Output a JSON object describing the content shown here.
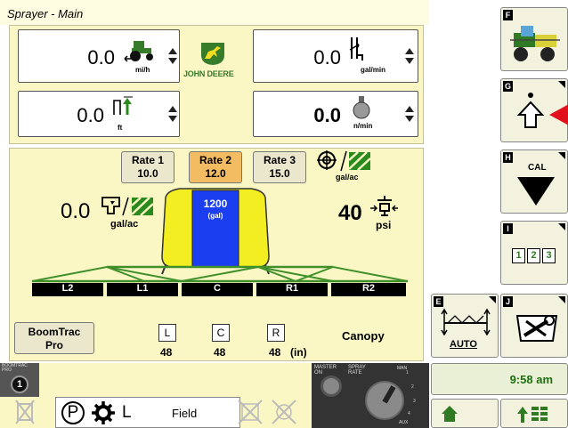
{
  "app": {
    "title": "Sprayer - Main",
    "brand": "JOHN DEERE"
  },
  "readouts": {
    "speed": {
      "value": "0.0",
      "unit": "mi/h"
    },
    "flow": {
      "value": "0.0",
      "unit": "gal/min"
    },
    "height": {
      "value": "0.0",
      "unit": "ft"
    },
    "fan": {
      "value": "0.0",
      "unit": "n/min"
    }
  },
  "rates": [
    {
      "label": "Rate 1",
      "value": "10.0",
      "active": false
    },
    {
      "label": "Rate 2",
      "value": "12.0",
      "active": true
    },
    {
      "label": "Rate 3",
      "value": "15.0",
      "active": false
    }
  ],
  "target_unit": "gal/ac",
  "applied_rate": {
    "value": "0.0",
    "unit": "gal/ac"
  },
  "tank": {
    "value": "1200",
    "unit": "(gal)"
  },
  "pressure": {
    "value": "40",
    "unit": "psi"
  },
  "boom_sections": [
    "L2",
    "L1",
    "C",
    "R1",
    "R2"
  ],
  "boomtrac": {
    "button_line1": "BoomTrac",
    "button_line2": "Pro",
    "sensors": [
      {
        "label": "L",
        "value": "48"
      },
      {
        "label": "C",
        "value": "48"
      },
      {
        "label": "R",
        "value": "48"
      }
    ],
    "unit": "(in)",
    "mode": "Canopy",
    "status_label": "BOOMTRAC PRO",
    "status_value": "1"
  },
  "spray_switch": {
    "master_label": "MASTER ON",
    "rate_label": "SPRAY RATE",
    "man_label": "MAN",
    "aux_label": "AUX",
    "scale": [
      "1",
      "2",
      "3",
      "4",
      "5"
    ]
  },
  "status_bar": {
    "park": "P",
    "gear": "L",
    "mode": "Field"
  },
  "sidebar": {
    "keys": [
      "F",
      "G",
      "H",
      "I",
      "E",
      "J"
    ],
    "cal_label": "CAL",
    "numbers": [
      "1",
      "2",
      "3"
    ],
    "auto_label": "AUTO",
    "clock": "9:58 am"
  },
  "colors": {
    "panel": "#fbf7c4",
    "rate_active": "#f3bb62",
    "tank_blue": "#1b3ff0",
    "tank_yellow": "#f2ee22",
    "boom_green": "#3f8f2a",
    "deere_green": "#367c2b",
    "clock_green": "#1f6f10",
    "arrow_red": "#e0101c"
  }
}
